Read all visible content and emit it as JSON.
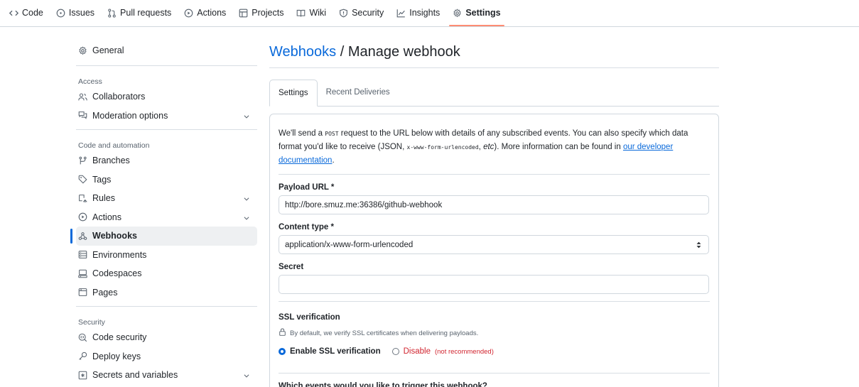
{
  "repo_nav": [
    {
      "label": "Code",
      "icon": "code-icon"
    },
    {
      "label": "Issues",
      "icon": "issue-opened-icon"
    },
    {
      "label": "Pull requests",
      "icon": "git-pull-request-icon"
    },
    {
      "label": "Actions",
      "icon": "play-icon"
    },
    {
      "label": "Projects",
      "icon": "table-icon"
    },
    {
      "label": "Wiki",
      "icon": "book-icon"
    },
    {
      "label": "Security",
      "icon": "shield-icon"
    },
    {
      "label": "Insights",
      "icon": "graph-icon"
    },
    {
      "label": "Settings",
      "icon": "gear-icon",
      "selected": true
    }
  ],
  "sidebar": {
    "general": "General",
    "access_heading": "Access",
    "collaborators": "Collaborators",
    "moderation": "Moderation options",
    "code_heading": "Code and automation",
    "branches": "Branches",
    "tags": "Tags",
    "rules": "Rules",
    "actions": "Actions",
    "webhooks": "Webhooks",
    "environments": "Environments",
    "codespaces": "Codespaces",
    "pages": "Pages",
    "security_heading": "Security",
    "code_security": "Code security",
    "deploy_keys": "Deploy keys",
    "secrets": "Secrets and variables"
  },
  "main": {
    "crumb": "Webhooks",
    "title_sep": " / ",
    "title": "Manage webhook",
    "tabs": [
      "Settings",
      "Recent Deliveries"
    ],
    "intro": {
      "p1": "We'll send a ",
      "post": "POST",
      "p2": " request to the URL below with details of any subscribed events. You can also specify which data format you'd like to receive (JSON, ",
      "form": "x-www-form-urlencoded",
      "p3": ", ",
      "etc": "etc",
      "p4": "). More information can be found in ",
      "link": "our developer documentation",
      "p5": "."
    },
    "payload_label": "Payload URL *",
    "payload_value": "http://bore.smuz.me:36386/github-webhook",
    "content_type_label": "Content type *",
    "content_type_value": "application/x-www-form-urlencoded",
    "secret_label": "Secret",
    "secret_value": "",
    "ssl_title": "SSL verification",
    "ssl_note": "By default, we verify SSL certificates when delivering payloads.",
    "ssl_enable": "Enable SSL verification",
    "ssl_disable": "Disable",
    "ssl_not_recommended": "(not recommended)",
    "events_question": "Which events would you like to trigger this webhook?"
  }
}
